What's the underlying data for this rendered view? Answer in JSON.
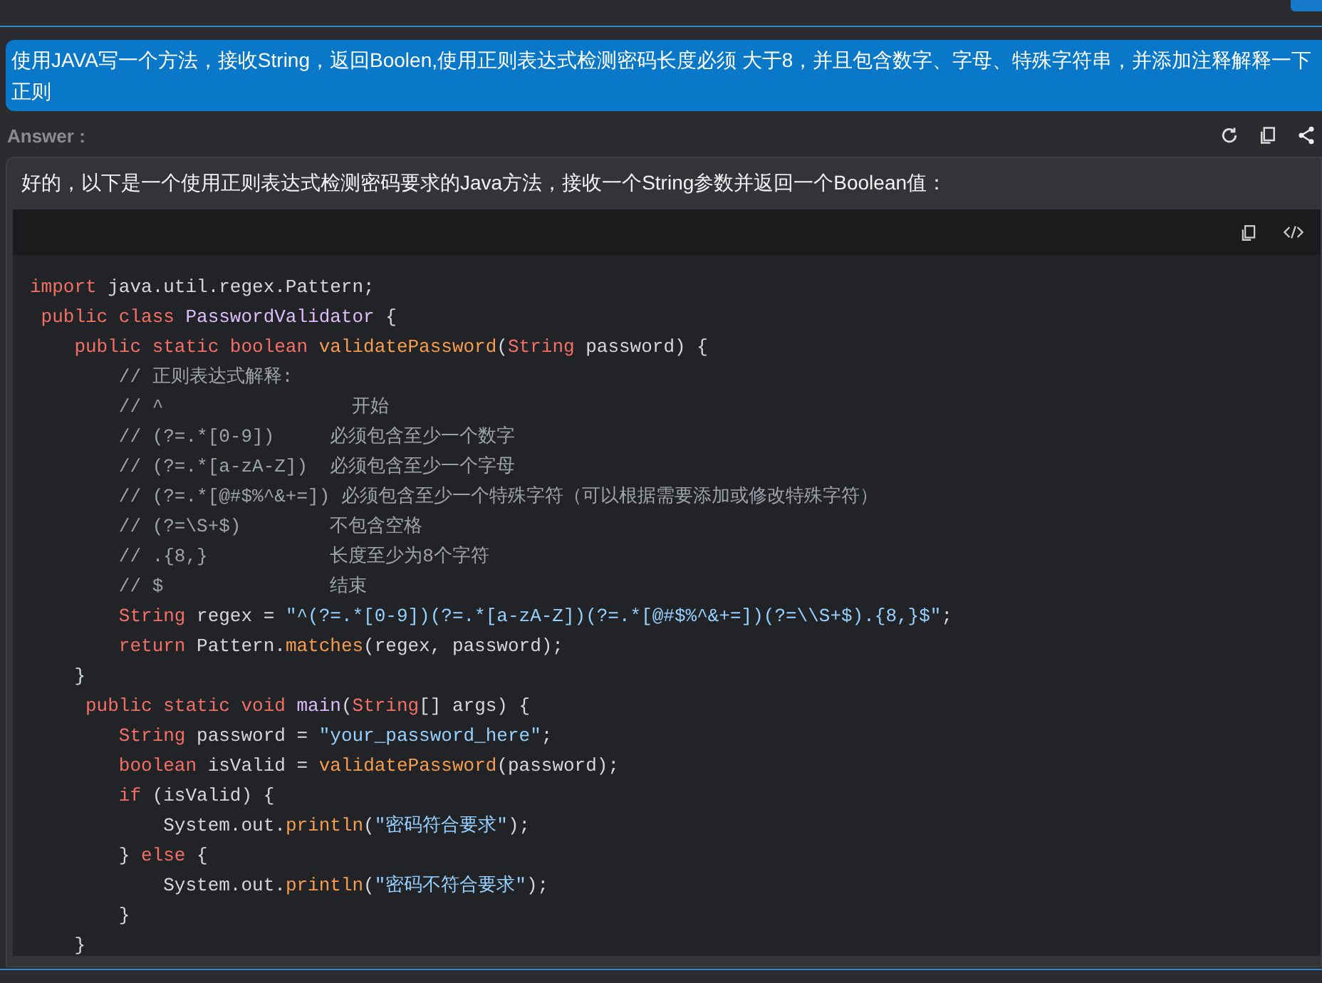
{
  "prompt": {
    "text": "使用JAVA写一个方法，接收String，返回Boolen,使用正则表达式检测密码长度必须 大于8，并且包含数字、字母、特殊字符串，并添加注释解释一下正则"
  },
  "answer_label": "Answer :",
  "answer": {
    "intro": "好的，以下是一个使用正则表达式检测密码要求的Java方法，接收一个String参数并返回一个Boolean值：",
    "code": {
      "lines": [
        [
          {
            "kind": "kw",
            "text": "import "
          },
          {
            "kind": "plain",
            "text": "java.util.regex.Pattern;"
          }
        ],
        [
          {
            "kind": "kw",
            "text": " public class "
          },
          {
            "kind": "title",
            "text": "PasswordValidator"
          },
          {
            "kind": "plain",
            "text": " {"
          }
        ],
        [
          {
            "kind": "kw",
            "text": "    public static boolean "
          },
          {
            "kind": "func",
            "text": "validatePassword"
          },
          {
            "kind": "plain",
            "text": "("
          },
          {
            "kind": "kw",
            "text": "String"
          },
          {
            "kind": "plain",
            "text": " password) {"
          }
        ],
        [
          {
            "kind": "comment",
            "text": "        // 正则表达式解释:"
          }
        ],
        [
          {
            "kind": "comment",
            "text": "        // ^                 开始"
          }
        ],
        [
          {
            "kind": "comment",
            "text": "        // (?=.*[0-9])     必须包含至少一个数字"
          }
        ],
        [
          {
            "kind": "comment",
            "text": "        // (?=.*[a-zA-Z])  必须包含至少一个字母"
          }
        ],
        [
          {
            "kind": "comment",
            "text": "        // (?=.*[@#$%^&+=]) 必须包含至少一个特殊字符（可以根据需要添加或修改特殊字符）"
          }
        ],
        [
          {
            "kind": "comment",
            "text": "        // (?=\\S+$)        不包含空格"
          }
        ],
        [
          {
            "kind": "comment",
            "text": "        // .{8,}           长度至少为8个字符"
          }
        ],
        [
          {
            "kind": "comment",
            "text": "        // $               结束"
          }
        ],
        [
          {
            "kind": "kw",
            "text": "        String"
          },
          {
            "kind": "plain",
            "text": " regex = "
          },
          {
            "kind": "str",
            "text": "\"^(?=.*[0-9])(?=.*[a-zA-Z])(?=.*[@#$%^&+=])(?=\\\\S+$).{8,}$\""
          },
          {
            "kind": "plain",
            "text": ";"
          }
        ],
        [
          {
            "kind": "kw",
            "text": "        return"
          },
          {
            "kind": "plain",
            "text": " Pattern."
          },
          {
            "kind": "func",
            "text": "matches"
          },
          {
            "kind": "plain",
            "text": "(regex, password);"
          }
        ],
        [
          {
            "kind": "plain",
            "text": "    }"
          }
        ],
        [
          {
            "kind": "kw",
            "text": "     public static void "
          },
          {
            "kind": "title",
            "text": "main"
          },
          {
            "kind": "plain",
            "text": "("
          },
          {
            "kind": "kw",
            "text": "String"
          },
          {
            "kind": "plain",
            "text": "[] args) {"
          }
        ],
        [
          {
            "kind": "kw",
            "text": "        String"
          },
          {
            "kind": "plain",
            "text": " password = "
          },
          {
            "kind": "str",
            "text": "\"your_password_here\""
          },
          {
            "kind": "plain",
            "text": ";"
          }
        ],
        [
          {
            "kind": "kw",
            "text": "        boolean"
          },
          {
            "kind": "plain",
            "text": " isValid = "
          },
          {
            "kind": "func",
            "text": "validatePassword"
          },
          {
            "kind": "plain",
            "text": "(password);"
          }
        ],
        [
          {
            "kind": "kw",
            "text": "        if"
          },
          {
            "kind": "plain",
            "text": " (isValid) {"
          }
        ],
        [
          {
            "kind": "plain",
            "text": "            System.out."
          },
          {
            "kind": "func",
            "text": "println"
          },
          {
            "kind": "plain",
            "text": "("
          },
          {
            "kind": "str",
            "text": "\"密码符合要求\""
          },
          {
            "kind": "plain",
            "text": ");"
          }
        ],
        [
          {
            "kind": "plain",
            "text": "        } "
          },
          {
            "kind": "kw",
            "text": "else"
          },
          {
            "kind": "plain",
            "text": " {"
          }
        ],
        [
          {
            "kind": "plain",
            "text": "            System.out."
          },
          {
            "kind": "func",
            "text": "println"
          },
          {
            "kind": "plain",
            "text": "("
          },
          {
            "kind": "str",
            "text": "\"密码不符合要求\""
          },
          {
            "kind": "plain",
            "text": ");"
          }
        ],
        [
          {
            "kind": "plain",
            "text": "        }"
          }
        ],
        [
          {
            "kind": "plain",
            "text": "    }"
          }
        ]
      ]
    }
  }
}
